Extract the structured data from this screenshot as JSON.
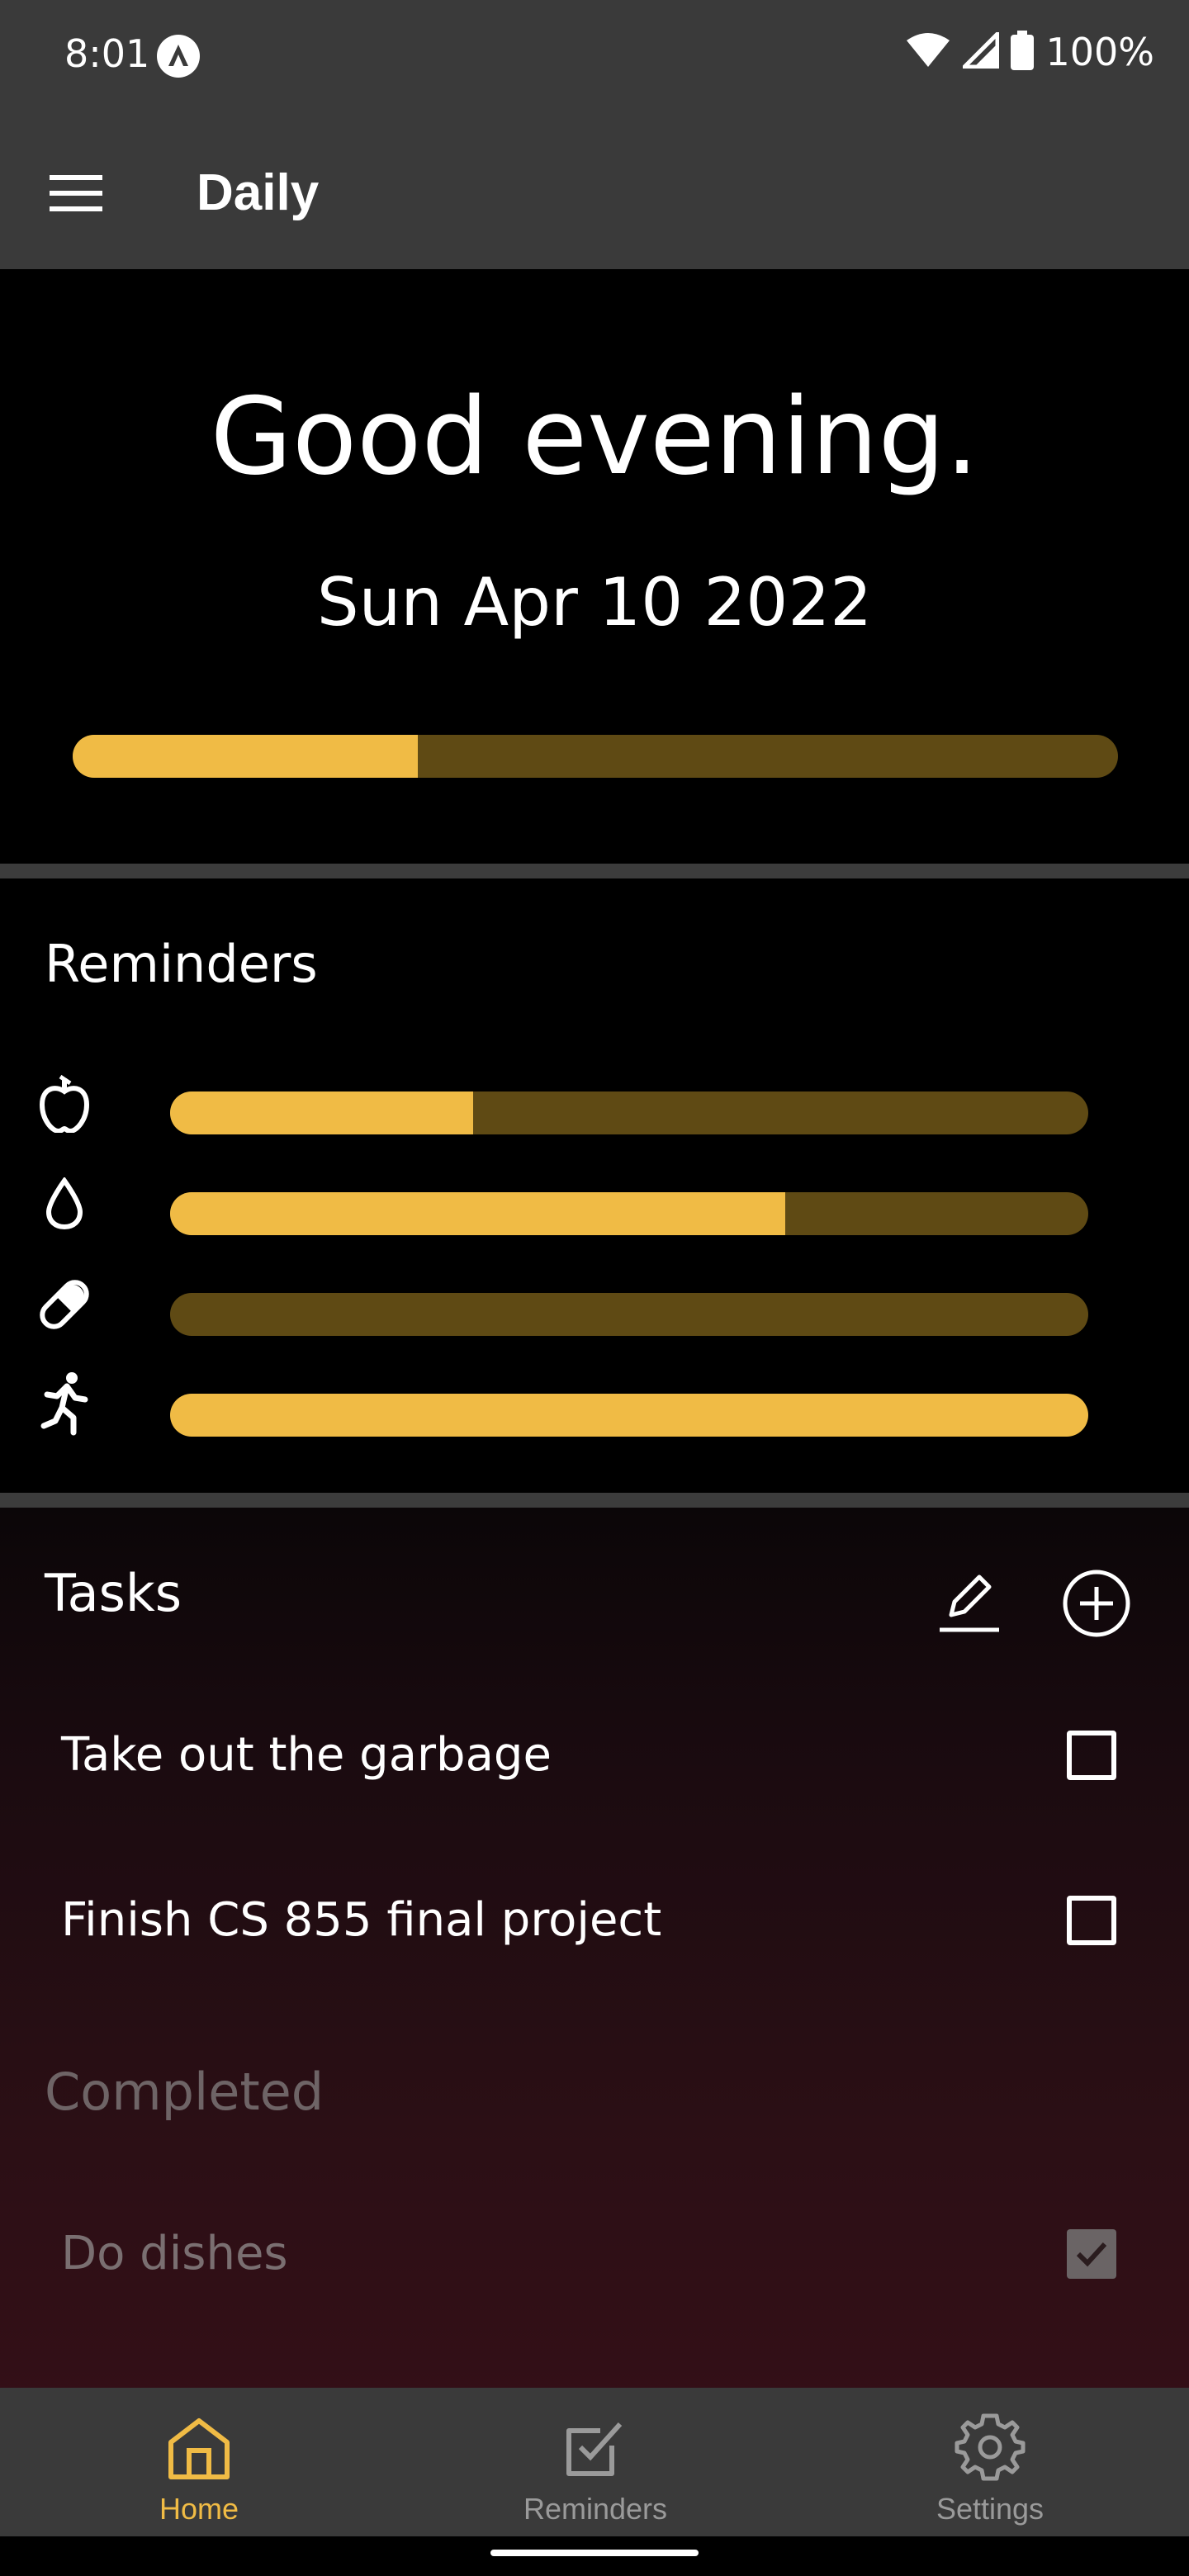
{
  "status_bar": {
    "time": "8:01",
    "battery": "100%"
  },
  "app_bar": {
    "title": "Daily"
  },
  "hero": {
    "greeting": "Good evening.",
    "date": "Sun Apr 10 2022",
    "day_progress": 0.33
  },
  "reminders": {
    "title": "Reminders",
    "items": [
      {
        "icon": "apple-icon",
        "progress": 0.33
      },
      {
        "icon": "water-drop-icon",
        "progress": 0.67
      },
      {
        "icon": "pill-icon",
        "progress": 0.0
      },
      {
        "icon": "running-icon",
        "progress": 1.0
      }
    ]
  },
  "tasks": {
    "title": "Tasks",
    "items": [
      {
        "label": "Take out the garbage",
        "checked": false
      },
      {
        "label": "Finish CS 855 final project",
        "checked": false
      }
    ],
    "completed_title": "Completed",
    "completed_items": [
      {
        "label": "Do dishes",
        "checked": true
      }
    ]
  },
  "bottom_nav": {
    "items": [
      {
        "label": "Home",
        "icon": "home-icon",
        "active": true
      },
      {
        "label": "Reminders",
        "icon": "checkbox-icon",
        "active": false
      },
      {
        "label": "Settings",
        "icon": "gear-icon",
        "active": false
      }
    ]
  },
  "colors": {
    "accent": "#f0bb45",
    "track": "#5f4a14",
    "bar_bg": "#3a3a3a",
    "inactive_nav": "#9a9a9a"
  }
}
